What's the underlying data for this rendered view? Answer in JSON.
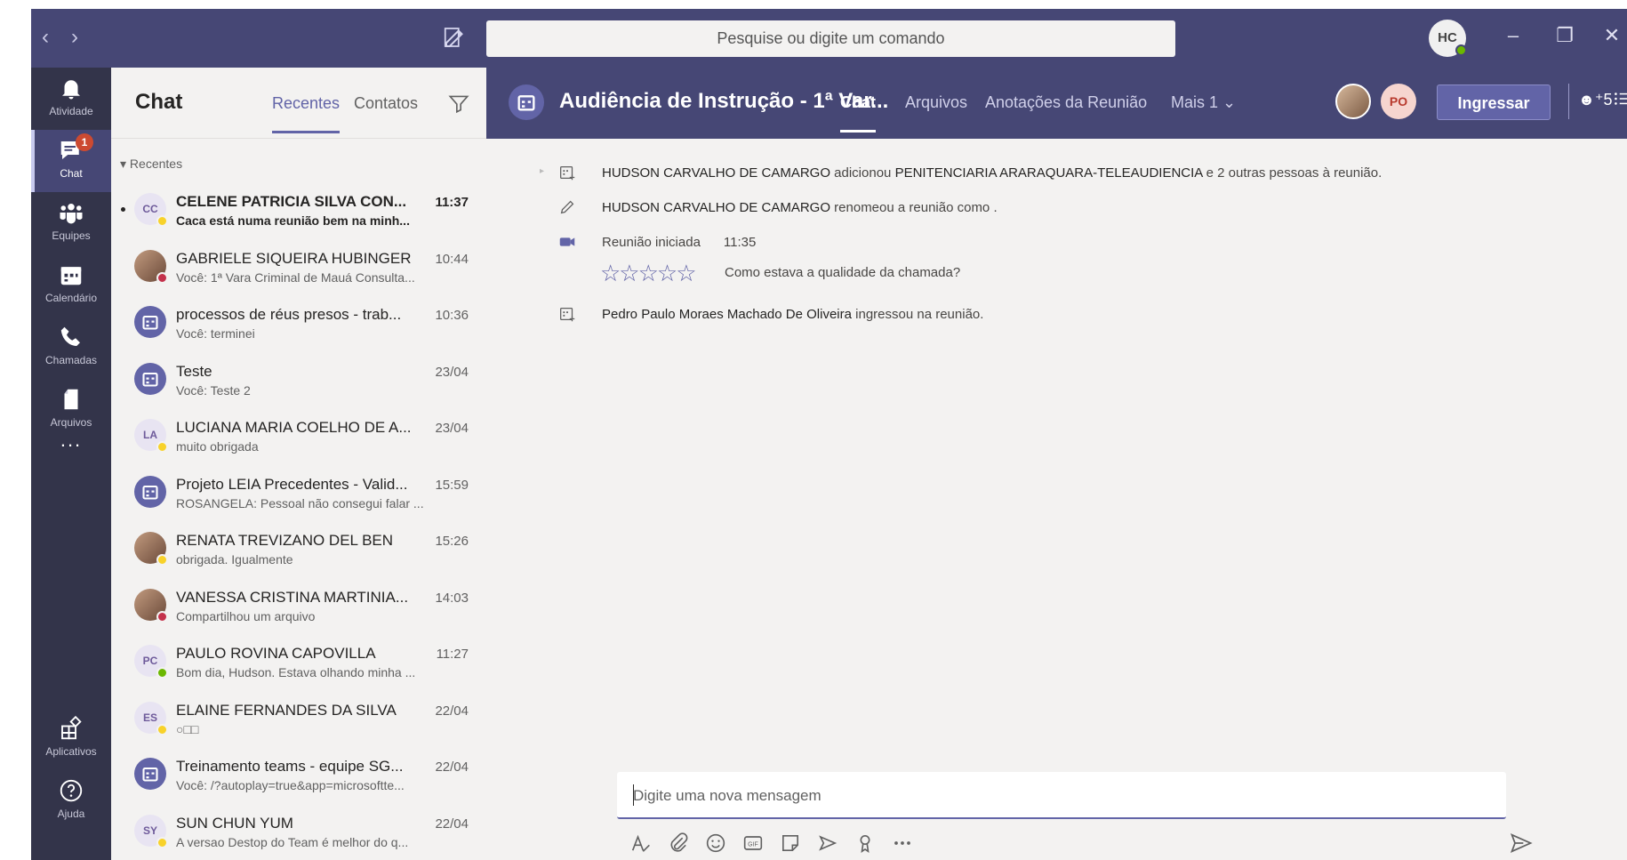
{
  "titlebar": {
    "search_placeholder": "Pesquise ou digite um comando",
    "user_initials": "HC"
  },
  "rail": {
    "items": [
      {
        "label": "Atividade"
      },
      {
        "label": "Chat",
        "badge": "1"
      },
      {
        "label": "Equipes"
      },
      {
        "label": "Calendário"
      },
      {
        "label": "Chamadas"
      },
      {
        "label": "Arquivos"
      },
      {
        "label": "..."
      },
      {
        "label": "Aplicativos"
      },
      {
        "label": "Ajuda"
      }
    ]
  },
  "chatlist": {
    "title": "Chat",
    "tabs": [
      "Recentes",
      "Contatos"
    ],
    "section": "Recentes",
    "items": [
      {
        "name": "CELENE PATRICIA SILVA CON...",
        "time": "11:37",
        "preview": "Caca está numa reunião bem na minh...",
        "avatar": "CC",
        "status": "away"
      },
      {
        "name": "GABRIELE SIQUEIRA HUBINGER",
        "time": "10:44",
        "preview": "Você: 1ª Vara Criminal de Mauá Consulta...",
        "avatar": "",
        "status": "busy"
      },
      {
        "name": "processos de réus presos - trab...",
        "time": "10:36",
        "preview": "Você: terminei",
        "avatar": "",
        "status": ""
      },
      {
        "name": "Teste",
        "time": "23/04",
        "preview": "Você: Teste 2",
        "avatar": "",
        "status": ""
      },
      {
        "name": "LUCIANA MARIA COELHO DE A...",
        "time": "23/04",
        "preview": "muito obrigada",
        "avatar": "LA",
        "status": "away"
      },
      {
        "name": "Projeto LEIA Precedentes - Valid...",
        "time": "15:59",
        "preview": "ROSANGELA: Pessoal não consegui falar ...",
        "avatar": "",
        "status": ""
      },
      {
        "name": "RENATA TREVIZANO DEL BEN",
        "time": "15:26",
        "preview": "obrigada. Igualmente",
        "avatar": "",
        "status": "away"
      },
      {
        "name": "VANESSA CRISTINA MARTINIA...",
        "time": "14:03",
        "preview": "Compartilhou um arquivo",
        "avatar": "",
        "status": "busy"
      },
      {
        "name": "PAULO ROVINA CAPOVILLA",
        "time": "11:27",
        "preview": "Bom dia, Hudson. Estava olhando minha ...",
        "avatar": "PC",
        "status": "avail"
      },
      {
        "name": "ELAINE FERNANDES DA SILVA",
        "time": "22/04",
        "preview": "○□□",
        "avatar": "ES",
        "status": "away"
      },
      {
        "name": "Treinamento teams - equipe SG...",
        "time": "22/04",
        "preview": "Você: /?autoplay=true&app=microsoftte...",
        "avatar": "",
        "status": ""
      },
      {
        "name": "SUN CHUN YUM",
        "time": "22/04",
        "preview": "A versao Destop do Team é melhor do q...",
        "avatar": "SY",
        "status": "away"
      }
    ]
  },
  "meeting": {
    "title": "Audiência de Instrução - 1ª Var...",
    "tabs": [
      "Chat",
      "Arquivos",
      "Anotações da Reunião",
      "Mais 1"
    ],
    "participant_initials": "PO",
    "join_label": "Ingressar",
    "people_count": "5",
    "events": [
      {
        "actor": "HUDSON CARVALHO DE CAMARGO",
        "text1": " adicionou ",
        "target": "PENITENCIARIA ARARAQUARA-TELEAUDIENCIA",
        "text2": " e 2 outras pessoas à reunião."
      },
      {
        "actor": "HUDSON CARVALHO DE CAMARGO",
        "text1": " renomeou a reunião como .",
        "target": "",
        "text2": ""
      },
      {
        "actor": "",
        "text1": "Reunião iniciada",
        "target": "",
        "text2": "11:35"
      },
      {
        "actor": "Pedro Paulo Moraes Machado De Oliveira",
        "text1": " ingressou na reunião.",
        "target": "",
        "text2": ""
      }
    ],
    "rating_prompt": "Como estava a qualidade da chamada?",
    "composer_placeholder": "Digite uma nova mensagem"
  }
}
